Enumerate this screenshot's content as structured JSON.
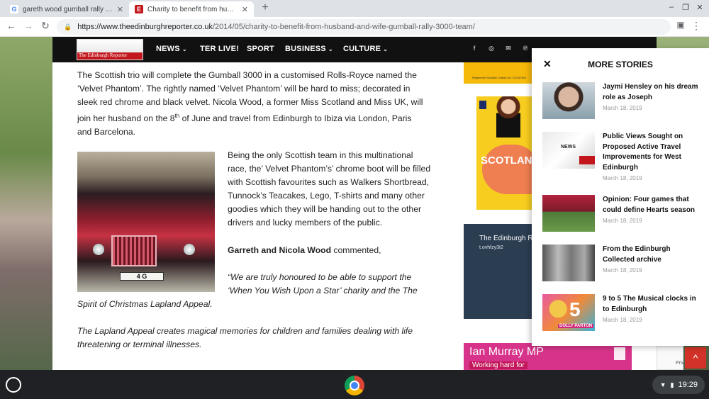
{
  "browser": {
    "tabs": [
      {
        "title": "gareth wood gumball rally - Goo",
        "favicon": "google-icon"
      },
      {
        "title": "Charity to benefit from husband",
        "favicon": "edinburgh-reporter-icon"
      }
    ],
    "new_tab_symbol": "+",
    "url_host": "https://www.theedinburghreporter.co.uk",
    "url_path": "/2014/05/charity-to-benefit-from-husband-and-wife-gumball-rally-3000-team/"
  },
  "site": {
    "logo_text": "The Edinburgh Reporter",
    "nav": [
      {
        "label": "NEWS",
        "dropdown": true
      },
      {
        "label": "TER LIVE!",
        "dropdown": false
      },
      {
        "label": "SPORT",
        "dropdown": false
      },
      {
        "label": "BUSINESS",
        "dropdown": true
      },
      {
        "label": "CULTURE",
        "dropdown": true
      }
    ],
    "social_icons": [
      "facebook-icon",
      "instagram-icon",
      "mail-icon",
      "pinterest-icon"
    ]
  },
  "article": {
    "p1": {
      "line1": "The Scottish trio will complete the Gumball 3000 in a customised Rolls-Royce named the",
      "line2": "‘Velvet Phantom’.  The rightly named ‘Velvet Phantom’ will be hard to miss; decorated in",
      "line3": "sleek red chrome and black velvet.  Nicola Wood, a former Miss Scotland and Miss UK, will",
      "line4_pre": "join her husband on the 8",
      "line4_sup": "th",
      "line4_post": " of June and travel from Edinburgh to Ibiza via London, Paris",
      "line5": "and Barcelona."
    },
    "p2_lines": [
      "Being the only Scottish team in this multinational",
      "race, the’ Velvet Phantom’s’ chrome boot will be filled",
      "with Scottish favourites such as Walkers Shortbread,",
      "Tunnock’s Teacakes, Lego, T-shirts and many other",
      "goodies which they will be handing out to the other",
      "drivers and lucky members of the public."
    ],
    "p3_bold": "Garreth and Nicola Wood",
    "p3_rest": " commented,",
    "quote_line1": "“We are truly honoured to be able to support the",
    "quote_line2": "‘When You Wish Upon a Star’ charity and the The",
    "quote_line3": "Spirit of Christmas Lapland Appeal.",
    "lapland_line1": "The Lapland Appeal creates magical memories for children and families dealing with life",
    "lapland_line2": "threatening or terminal illnesses.",
    "car_plate": "4 G"
  },
  "ads": {
    "top_small": "Registered Scottish Charity No. SC037450",
    "scotland_word": "SCOTLAND",
    "blue_title": "The Edinburgh R",
    "blue_sub": "t.ovhfzy3t2",
    "mp_name": "Ian Murray MP",
    "mp_sub": "Working hard for"
  },
  "more_stories": {
    "heading": "MORE STORIES",
    "close": "✕",
    "items": [
      {
        "title": "Jaymi Hensley on his dream role as Joseph",
        "date": "March 18, 2019"
      },
      {
        "title": "Public Views Sought on Proposed Active Travel Improvements for West Edinburgh",
        "date": "March 18, 2019"
      },
      {
        "title": "Opinion: Four games that could define Hearts season",
        "date": "March 18, 2019"
      },
      {
        "title": "From the Edinburgh Collected archive",
        "date": "March 18, 2019"
      },
      {
        "title": "9 to 5 The Musical clocks in to Edinburgh",
        "date": "March 18, 2019"
      }
    ],
    "thumb2_text": "NEWS",
    "thumb5_num": "5",
    "thumb5_sub": "DOLLY PARTON"
  },
  "widgets": {
    "recaptcha_text": "Priva",
    "scroll_up": "^"
  },
  "shelf": {
    "time": "19:29"
  }
}
